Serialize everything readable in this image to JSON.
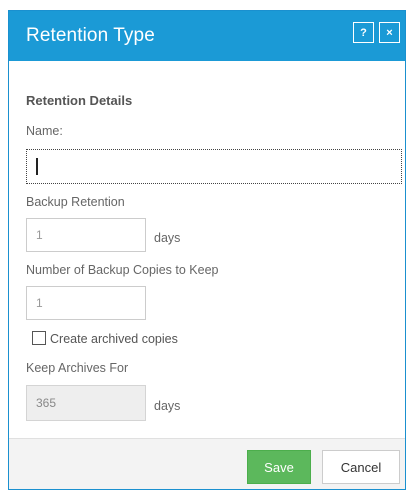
{
  "dialog": {
    "title": "Retention Type",
    "help_label": "?",
    "close_label": "×"
  },
  "form": {
    "section_title": "Retention Details",
    "name_label": "Name:",
    "name_value": "",
    "backup_retention_label": "Backup Retention",
    "backup_retention_value": "1",
    "backup_retention_unit": "days",
    "copies_label": "Number of Backup Copies to Keep",
    "copies_value": "1",
    "create_archived_label": "Create archived copies",
    "create_archived_checked": false,
    "keep_archives_label": "Keep Archives For",
    "keep_archives_value": "365",
    "keep_archives_unit": "days"
  },
  "footer": {
    "save_label": "Save",
    "cancel_label": "Cancel"
  },
  "colors": {
    "titlebar": "#1b9ad6",
    "save_button": "#5cb85c"
  }
}
